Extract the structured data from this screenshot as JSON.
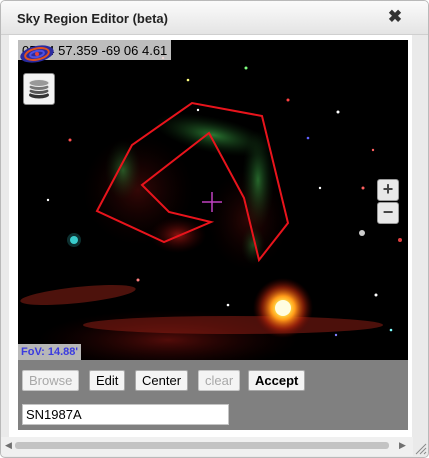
{
  "window": {
    "title": "Sky Region Editor (beta)",
    "close_symbol": "✖"
  },
  "viewer": {
    "coordinates": "05 34 57.359 -69 06 4.61",
    "fov_text": "FoV: 14.88'",
    "zoom_in": "+",
    "zoom_out": "−",
    "region_color": "#e8141c",
    "center_marker_color": "#c040c0"
  },
  "toolbar": {
    "browse": "Browse",
    "edit": "Edit",
    "center": "Center",
    "clear": "clear",
    "accept": "Accept"
  },
  "target": {
    "value": "SN1987A"
  }
}
